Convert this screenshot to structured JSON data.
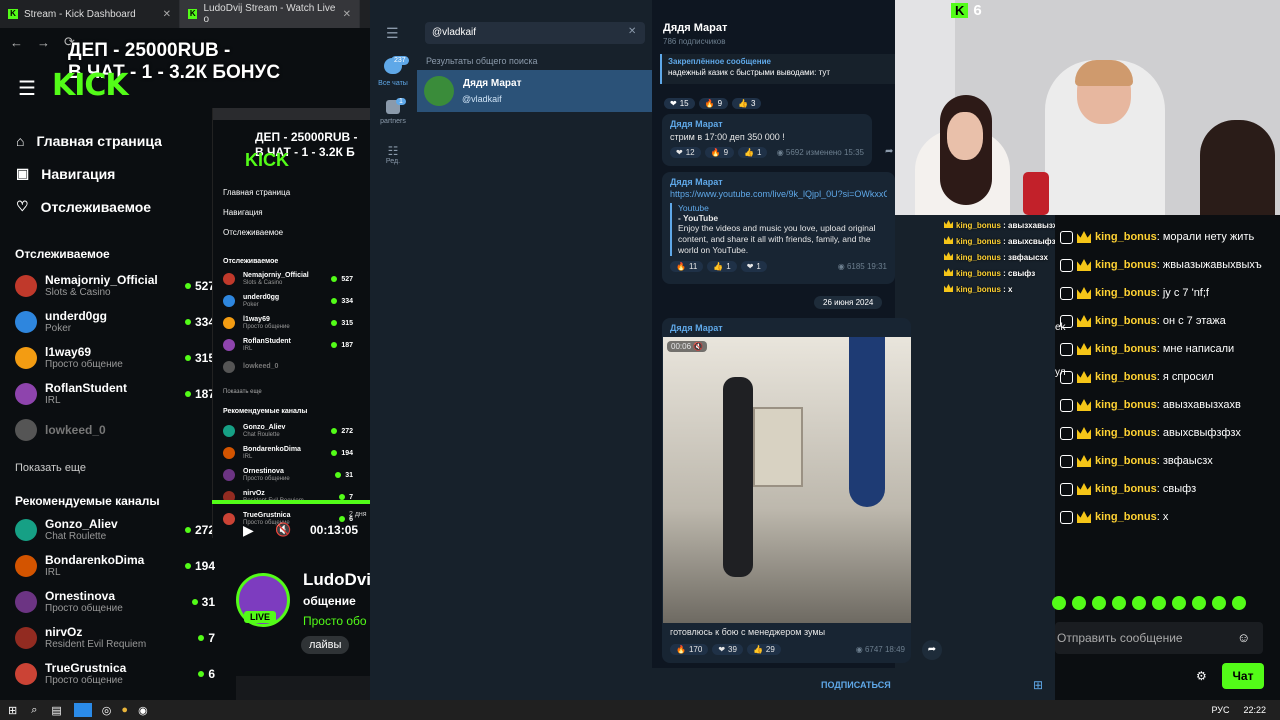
{
  "browser": {
    "tabs": [
      {
        "label": "Stream - Kick Dashboard"
      },
      {
        "label": "LudoDvij Stream - Watch Live o"
      }
    ]
  },
  "overlay": {
    "line1": "ДЕП - 25000RUB -",
    "line2": "В ЧАТ - 1 - 3.2К БОНУС"
  },
  "kick": {
    "logo": "KICK",
    "nav": [
      {
        "label": "Главная страница"
      },
      {
        "label": "Навигация"
      },
      {
        "label": "Отслеживаемое"
      }
    ],
    "followed_title": "Отслеживаемое",
    "followed": [
      {
        "name": "Nemajorniy_Official",
        "sub": "Slots & Casino",
        "count": "527",
        "color": "#c0392b"
      },
      {
        "name": "underd0gg",
        "sub": "Poker",
        "count": "334",
        "color": "#2e86de"
      },
      {
        "name": "l1way69",
        "sub": "Просто общение",
        "count": "315",
        "color": "#f39c12"
      },
      {
        "name": "RoflanStudent",
        "sub": "IRL",
        "count": "187",
        "color": "#8e44ad"
      },
      {
        "name": "lowkeed_0",
        "sub": "",
        "count": "",
        "color": "#555"
      }
    ],
    "show_more": "Показать еще",
    "recommended_title": "Рекомендуемые каналы",
    "recommended": [
      {
        "name": "Gonzo_Aliev",
        "sub": "Chat Roulette",
        "count": "272",
        "color": "#16a085"
      },
      {
        "name": "BondarenkoDima",
        "sub": "IRL",
        "count": "194",
        "color": "#d35400"
      },
      {
        "name": "Ornestinova",
        "sub": "Просто общение",
        "count": "31",
        "color": "#6c3483"
      },
      {
        "name": "nirvOz",
        "sub": "Resident Evil Requiem",
        "count": "7",
        "color": "#922b21"
      },
      {
        "name": "TrueGrustnica",
        "sub": "Просто общение",
        "count": "6",
        "color": "#cb4335"
      }
    ],
    "player_time": "00:13:05",
    "inner_overlay1": "ДЕП - 25000RUB -",
    "inner_overlay2": "В ЧАТ - 1 - 3.2К Б",
    "inner_time_ago": "2 дня",
    "streamer": {
      "name": "LudoDvij",
      "category": "общение",
      "title": "Просто обо",
      "live": "LIVE",
      "tag": "лайвы"
    }
  },
  "telegram": {
    "rail": [
      {
        "label": "Все чаты",
        "badge": "237"
      },
      {
        "label": "partners",
        "badge": "1"
      },
      {
        "label": "Ред."
      }
    ],
    "search_value": "@vladkaif",
    "results_title": "Результаты общего поиска",
    "result": {
      "name": "Дядя Марат",
      "handle": "@vladkaif"
    },
    "channel": {
      "name": "Дядя Марат",
      "subs": "786 подписчиков"
    },
    "pinned": {
      "title": "Закреплённое сообщение",
      "text": "надежный казик с быстрыми выводами: тут"
    },
    "pinned_reacts": [
      {
        "e": "❤",
        "n": "15"
      },
      {
        "e": "🔥",
        "n": "9"
      },
      {
        "e": "👍",
        "n": "3"
      }
    ],
    "msg1": {
      "author": "Дядя Марат",
      "text": "стрим в 17:00 деп 350 000 !",
      "reacts": [
        {
          "e": "❤",
          "n": "12"
        },
        {
          "e": "🔥",
          "n": "9"
        },
        {
          "e": "👍",
          "n": "1"
        }
      ],
      "views": "5692",
      "time": "изменено 15:35"
    },
    "msg2": {
      "author": "Дядя Марат",
      "link": "https://www.youtube.com/live/9k_lQjpl_0U?si=OWkxxC3",
      "preview_site": "Youtube",
      "preview_title": "- YouTube",
      "preview_text": "Enjoy the videos and music you love, upload original content, and share it all with friends, family, and the world on YouTube.",
      "reacts": [
        {
          "e": "🔥",
          "n": "11"
        },
        {
          "e": "👍",
          "n": "1"
        },
        {
          "e": "❤",
          "n": "1"
        }
      ],
      "views": "6185",
      "time": "19:31"
    },
    "date": "26 июня 2024",
    "msg3": {
      "author": "Дядя Марат",
      "video_time": "00:06",
      "caption": "готовлюсь к бою с менеджером зумы",
      "reacts": [
        {
          "e": "🔥",
          "n": "170"
        },
        {
          "e": "❤",
          "n": "39"
        },
        {
          "e": "👍",
          "n": "29"
        }
      ],
      "views": "6747",
      "time": "18:49"
    },
    "subscribe": "ПОДПИСАТЬСЯ"
  },
  "cam": {
    "viewers": "6"
  },
  "mini_chat": [
    {
      "user": "king_bonus",
      "text": "авызхавызхахв"
    },
    {
      "user": "king_bonus",
      "text": "авыхсвыфзфзх"
    },
    {
      "user": "king_bonus",
      "text": "звфаысзх"
    },
    {
      "user": "king_bonus",
      "text": "свыфз"
    },
    {
      "user": "king_bonus",
      "text": "х"
    }
  ],
  "chat": {
    "messages": [
      {
        "user": "king_bonus",
        "text": "морали нету жить"
      },
      {
        "user": "king_bonus",
        "text": "жвыазыжавыхвыхъ"
      },
      {
        "user": "king_bonus",
        "text": "jy c 7 'nf;f"
      },
      {
        "user": "king_bonus",
        "text": "он с 7 этажа"
      },
      {
        "user": "king_bonus",
        "text": "мне написали"
      },
      {
        "user": "king_bonus",
        "text": "я спросил"
      },
      {
        "user": "king_bonus",
        "text": "авызхавызхахв"
      },
      {
        "user": "king_bonus",
        "text": "авыхсвыфзфзх"
      },
      {
        "user": "king_bonus",
        "text": "звфаысзх"
      },
      {
        "user": "king_bonus",
        "text": "свыфз"
      },
      {
        "user": "king_bonus",
        "text": "х"
      }
    ],
    "side_fragments": [
      "ek",
      "ул"
    ],
    "input_placeholder": "Отправить сообщение",
    "send_label": "Чат"
  },
  "taskbar": {
    "lang": "РУС",
    "time": "22:22"
  }
}
